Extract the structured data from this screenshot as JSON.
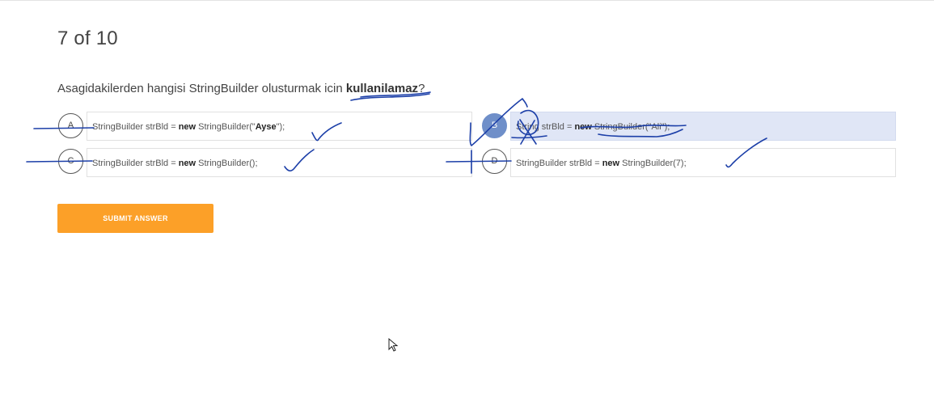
{
  "quiz": {
    "counter": "7 of 10",
    "question_prefix": "Asagidakilerden hangisi StringBuilder olusturmak icin ",
    "question_emphasis": "kullanilamaz",
    "question_suffix": "?"
  },
  "options": [
    {
      "letter": "A",
      "pre": "StringBuilder strBld = ",
      "kw": "new",
      "mid": " StringBuilder(\"",
      "arg": "Ayse",
      "post": "\");",
      "selected": false
    },
    {
      "letter": "B",
      "pre": "String strBld = ",
      "kw": "new",
      "mid": " StringBuilder(\"Ali\");",
      "arg": "",
      "post": "",
      "selected": true
    },
    {
      "letter": "C",
      "pre": "StringBuilder strBld = ",
      "kw": "new",
      "mid": " StringBuilder();",
      "arg": "",
      "post": "",
      "selected": false
    },
    {
      "letter": "D",
      "pre": "StringBuilder strBld = ",
      "kw": "new",
      "mid": " StringBuilder(7);",
      "arg": "",
      "post": "",
      "selected": false
    }
  ],
  "submit_label": "SUBMIT ANSWER",
  "colors": {
    "accent": "#fca028",
    "selected_bg": "#e0e6f6",
    "selected_circle": "#6f8fc9",
    "annotation_ink": "#1c3fa8"
  }
}
